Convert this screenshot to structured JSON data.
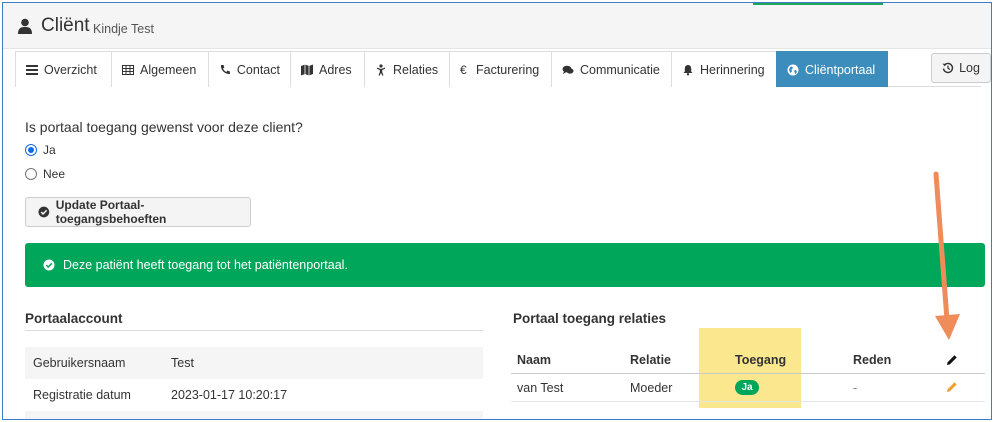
{
  "header": {
    "title": "Cliënt",
    "subtitle": "Kindje Test"
  },
  "tabs": [
    {
      "label": "Overzicht",
      "icon": "list-icon"
    },
    {
      "label": "Algemeen",
      "icon": "table-icon"
    },
    {
      "label": "Contact",
      "icon": "phone-icon"
    },
    {
      "label": "Adres",
      "icon": "map-icon"
    },
    {
      "label": "Relaties",
      "icon": "child-icon"
    },
    {
      "label": "Facturering",
      "icon": "euro-icon"
    },
    {
      "label": "Communicatie",
      "icon": "comments-icon"
    },
    {
      "label": "Herinnering",
      "icon": "bell-icon"
    },
    {
      "label": "Cliëntportaal",
      "icon": "globe-icon",
      "active": true
    }
  ],
  "log_button": {
    "label": "Log"
  },
  "portal": {
    "question": "Is portaal toegang gewenst voor deze client?",
    "options": [
      "Ja",
      "Nee"
    ],
    "selected": "Ja",
    "update_button": "Update Portaal-toegangsbehoeften",
    "alert": "Deze patiënt heeft toegang tot het patiëntenportaal."
  },
  "account": {
    "title": "Portaalaccount",
    "rows": [
      {
        "label": "Gebruikersnaam",
        "value": "Test"
      },
      {
        "label": "Registratie datum",
        "value": "2023-01-17 10:20:17"
      }
    ]
  },
  "relations": {
    "title": "Portaal toegang relaties",
    "headers": {
      "name": "Naam",
      "relation": "Relatie",
      "access": "Toegang",
      "reason": "Reden"
    },
    "rows": [
      {
        "name": "van Test",
        "relation": "Moeder",
        "access": "Ja",
        "reason": "-"
      }
    ]
  },
  "colors": {
    "primary": "#3c8dbc",
    "success": "#00a65a",
    "highlight": "#f9e37a",
    "annotation": "#f08c5a",
    "edit": "#f0a030"
  }
}
